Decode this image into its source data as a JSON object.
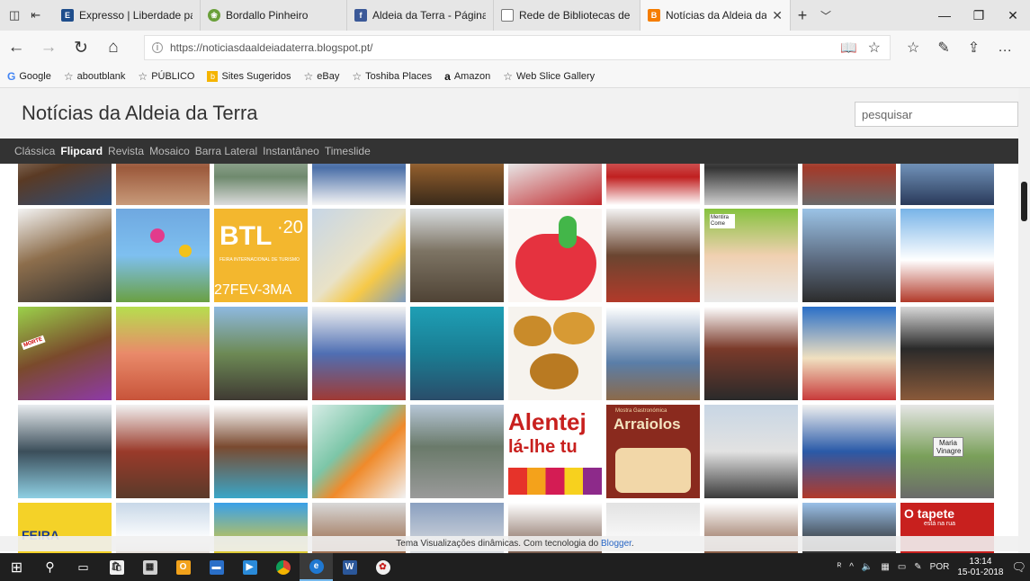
{
  "browser": {
    "tabs": [
      {
        "title": "Expresso | Liberdade para p",
        "favicon": "expresso-icon",
        "color": "#1f4e8c"
      },
      {
        "title": "Bordallo Pinheiro",
        "favicon": "bordallo-icon",
        "color": "#6aa03a"
      },
      {
        "title": "Aldeia da Terra - Página inic",
        "favicon": "facebook-icon",
        "color": "#3b5998"
      },
      {
        "title": "Rede de Bibliotecas de Lisb",
        "favicon": "page-icon",
        "color": "#777777"
      },
      {
        "title": "Notícias da Aldeia da Te",
        "favicon": "blogger-icon",
        "color": "#f57d00",
        "active": true
      }
    ],
    "url": "https://noticiasdaaldeiadaterra.blogspot.pt/",
    "favorites": [
      "Google",
      "aboutblank",
      "PÚBLICO",
      "Sites Sugeridos",
      "eBay",
      "Toshiba Places",
      "Amazon",
      "Web Slice Gallery"
    ]
  },
  "blog": {
    "title": "Notícias da Aldeia da Terra",
    "search_placeholder": "pesquisar",
    "views": [
      "Clássica",
      "Flipcard",
      "Revista",
      "Mosaico",
      "Barra Lateral",
      "Instantâneo",
      "Timeslide"
    ],
    "active_view": "Flipcard",
    "footer_text": "Tema Visualizações dinâmicas. Com tecnologia do ",
    "footer_link": "Blogger",
    "footer_period": ".",
    "tile_texts": {
      "btl": "BTL",
      "btl_year": "·20",
      "btl_sub": "FEIRA INTERNACIONAL DE TURISMO",
      "btl_date": "27FEV-3MA",
      "alentejo_1": "Alentej",
      "alentejo_2": "lá-lhe tu",
      "arraiolos_small": "Mostra Gastronómica",
      "arraiolos_big": "Arraiolos",
      "maria_vinagre": "Maria Vinagre",
      "tapete": "O tapete",
      "tapete_sub": "está na rua",
      "feira": "FEIRA",
      "morte": "MORTE",
      "mentira": "Mentira Come"
    }
  },
  "taskbar": {
    "apps": [
      "windows-start",
      "search",
      "task-view",
      "store",
      "calculator",
      "outlook",
      "file-explorer",
      "media",
      "chrome",
      "edge",
      "word",
      "paint"
    ],
    "language": "POR",
    "time": "13:14",
    "date": "15-01-2018"
  }
}
